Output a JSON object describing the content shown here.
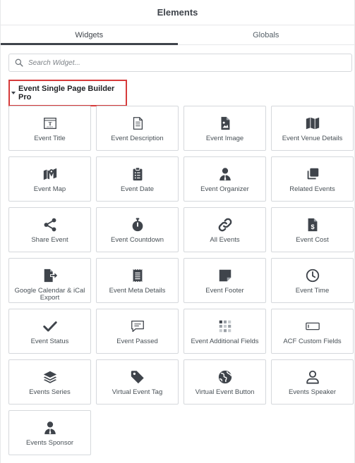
{
  "header": {
    "title": "Elements"
  },
  "tabs": [
    {
      "label": "Widgets",
      "active": true
    },
    {
      "label": "Globals",
      "active": false
    }
  ],
  "search": {
    "placeholder": "Search Widget..."
  },
  "category": {
    "label": "Event Single Page Builder Pro"
  },
  "colors": {
    "highlight": "#d63b3b",
    "icon": "#3f444b"
  },
  "widgets": [
    {
      "label": "Event Title",
      "icon": "title-icon"
    },
    {
      "label": "Event Description",
      "icon": "document-icon"
    },
    {
      "label": "Event Image",
      "icon": "image-file-icon"
    },
    {
      "label": "Event Venue Details",
      "icon": "map-icon"
    },
    {
      "label": "Event Map",
      "icon": "map-marker-icon"
    },
    {
      "label": "Event Date",
      "icon": "clipboard-list-icon"
    },
    {
      "label": "Event Organizer",
      "icon": "user-tie-icon"
    },
    {
      "label": "Related Events",
      "icon": "clone-icon"
    },
    {
      "label": "Share Event",
      "icon": "share-icon"
    },
    {
      "label": "Event Countdown",
      "icon": "stopwatch-icon"
    },
    {
      "label": "All Events",
      "icon": "link-icon"
    },
    {
      "label": "Event Cost",
      "icon": "invoice-dollar-icon"
    },
    {
      "label": "Google Calendar & iCal Export",
      "icon": "file-export-icon"
    },
    {
      "label": "Event Meta Details",
      "icon": "receipt-icon"
    },
    {
      "label": "Event Footer",
      "icon": "sticky-note-icon"
    },
    {
      "label": "Event Time",
      "icon": "clock-icon"
    },
    {
      "label": "Event Status",
      "icon": "check-icon"
    },
    {
      "label": "Event Passed",
      "icon": "comment-icon"
    },
    {
      "label": "Event Additional Fields",
      "icon": "grid-icon"
    },
    {
      "label": "ACF Custom Fields",
      "icon": "input-field-icon"
    },
    {
      "label": "Events Series",
      "icon": "layers-icon"
    },
    {
      "label": "Virtual Event Tag",
      "icon": "tag-icon"
    },
    {
      "label": "Virtual Event Button",
      "icon": "globe-icon"
    },
    {
      "label": "Events Speaker",
      "icon": "person-icon"
    },
    {
      "label": "Events Sponsor",
      "icon": "user-tie-icon"
    }
  ]
}
